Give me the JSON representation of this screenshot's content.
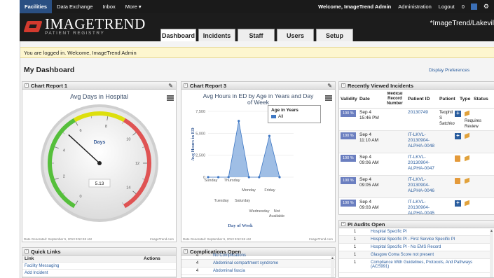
{
  "topnav": {
    "left": [
      "Facilities",
      "Data Exchange",
      "Inbox",
      "More ▾"
    ],
    "welcome": "Welcome, ImageTrend Admin",
    "admin": "Administration",
    "logout": "Logout",
    "count": "0",
    "gear": "⚙"
  },
  "logo": {
    "big": "IMAGETREND",
    "small": "PATIENT REGISTRY"
  },
  "site_name": "*ImageTrend/Lakevil",
  "tabs": [
    "Dashboard",
    "Incidents",
    "Staff",
    "Users",
    "Setup"
  ],
  "welcome_msg": "You are logged in. Welcome, ImageTrend Admin",
  "dashboard_title": "My Dashboard",
  "display_prefs": "Display Preferences",
  "chart1": {
    "panel_title": "Chart Report 1",
    "chart_title": "Avg Days in Hospital",
    "gauge_label": "Days",
    "ticks": [
      "0",
      "2",
      "4",
      "6",
      "8",
      "10",
      "12",
      "14"
    ],
    "value_text": "5.13",
    "footer_left": "Date Generated: September 5, 2013 9:52:48 AM",
    "footer_right": "ImageTrend.com"
  },
  "chart2": {
    "panel_title": "Chart Report 3",
    "chart_title_1": "Avg Hours in ED by Age in Years and Day",
    "chart_title_2": "of Week",
    "ylabel": "Avg Hours in ED",
    "xlabel": "Day of Week",
    "yticks": [
      "7,500",
      "5,000",
      "2,500",
      "0"
    ],
    "legend_title": "Age in Years",
    "legend_item": "All",
    "footer_left": "Date Generated: September 5, 2013 9:52:48 AM",
    "footer_right": "ImageTrend.com"
  },
  "chart_data": [
    {
      "type": "gauge",
      "title": "Avg Days in Hospital",
      "value": 5.13,
      "range": [
        0,
        15
      ],
      "label": "Days",
      "bands": [
        {
          "from": 0,
          "to": 6,
          "color": "#55bf3b"
        },
        {
          "from": 6,
          "to": 9,
          "color": "#dddf0d"
        },
        {
          "from": 9,
          "to": 15,
          "color": "#df5353"
        }
      ]
    },
    {
      "type": "area",
      "title": "Avg Hours in ED by Age in Years and Day of Week",
      "xlabel": "Day of Week",
      "ylabel": "Avg Hours in ED",
      "ylim": [
        0,
        7500
      ],
      "categories": [
        "Sunday",
        "Monday",
        "Tuesday",
        "Wednesday",
        "Thursday",
        "Friday",
        "Saturday",
        "Not Available"
      ],
      "series": [
        {
          "name": "All",
          "values": [
            0,
            0,
            0,
            6400,
            0,
            0,
            4700,
            0
          ]
        }
      ],
      "colors": {
        "fill": "#7fa8dc",
        "line": "#3f78c4"
      }
    }
  ],
  "recent": {
    "panel_title": "Recently Viewed Incidents",
    "headers": [
      "Validity",
      "Date",
      "Medical Record Number",
      "Patient ID",
      "Patient",
      "Type",
      "Status"
    ],
    "rows": [
      {
        "validity": "100 %",
        "date": "Sep 4\n15:46 PM",
        "mrn": "",
        "pid": "20130749",
        "patient": "Teophil S\nSatchkov",
        "type": "plus",
        "status": "Requires\nReview"
      },
      {
        "validity": "100 %",
        "date": "Sep 4\n11:10 AM",
        "mrn": "",
        "pid": "IT-LKVL-\n20130904-\nALPHA-0048",
        "patient": "",
        "type": "plus",
        "status": ""
      },
      {
        "validity": "100 %",
        "date": "Sep 4\n09:06 AM",
        "mrn": "",
        "pid": "IT-LKVL-\n20130904-\nALPHA-0047",
        "patient": "",
        "type": "fire",
        "status": ""
      },
      {
        "validity": "100 %",
        "date": "Sep 4\n09:05 AM",
        "mrn": "",
        "pid": "IT-LKVL-\n20130904-\nALPHA-0046",
        "patient": "",
        "type": "fire",
        "status": ""
      },
      {
        "validity": "100 %",
        "date": "Sep 4\n09:03 AM",
        "mrn": "",
        "pid": "IT-LKVL-\n20130904-\nALPHA-0045",
        "patient": "",
        "type": "plus",
        "status": ""
      }
    ]
  },
  "pi": {
    "panel_title": "PI Audits Open",
    "rows": [
      {
        "n": "1",
        "t": "Hospital Specific PI"
      },
      {
        "n": "1",
        "t": "Hospital Specific PI - First Service Specific PI"
      },
      {
        "n": "1",
        "t": "Hospital Specific PI - No EMS Record"
      },
      {
        "n": "1",
        "t": "Glasgow Coma Score not present"
      },
      {
        "n": "1",
        "t": "Compliance With Guidelines, Protocols, And Pathways (ACS991)"
      }
    ]
  },
  "quick": {
    "panel_title": "Quick Links",
    "col_link": "Link",
    "col_actions": "Actions",
    "items": [
      "Facility Messaging",
      "Add Incident"
    ]
  },
  "complications": {
    "panel_title": "Complications Open",
    "rows": [
      {
        "n": "4",
        "t": "No Complications"
      },
      {
        "n": "4",
        "t": "Abdominal compartment syndrome"
      },
      {
        "n": "4",
        "t": "Abdominal fascia"
      }
    ]
  }
}
